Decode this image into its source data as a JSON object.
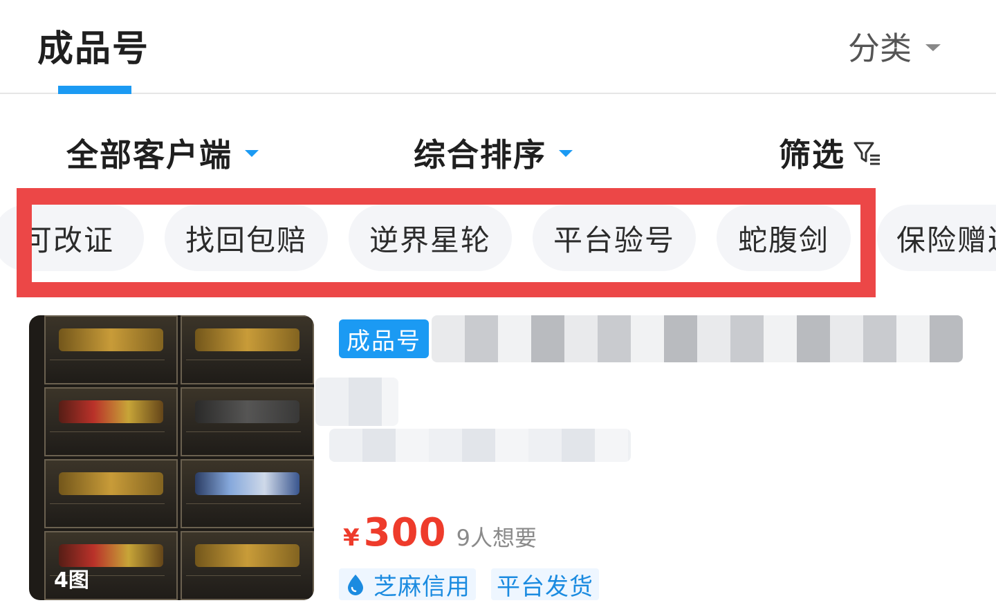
{
  "header": {
    "tab_label": "成品号",
    "category_label": "分类"
  },
  "filters": {
    "client": "全部客户端",
    "sort": "综合排序",
    "screen": "筛选"
  },
  "chips": [
    "可改证",
    "找回包赔",
    "逆界星轮",
    "平台验号",
    "蛇腹剑",
    "保险赠送"
  ],
  "product": {
    "type_badge": "成品号",
    "image_count": "4图",
    "currency": "¥",
    "price": "300",
    "wants": "9人想要",
    "tags": [
      "芝麻信用",
      "平台发货"
    ]
  },
  "colors": {
    "accent": "#1b9af3",
    "price": "#ee3b2b",
    "highlight_frame": "#ec4747",
    "chip_bg": "#f4f5f8"
  },
  "icons": {
    "category_caret": "caret-down-icon",
    "filter_caret": "caret-down-icon",
    "screen": "filter-funnel-icon",
    "zhima": "water-drop-icon"
  }
}
